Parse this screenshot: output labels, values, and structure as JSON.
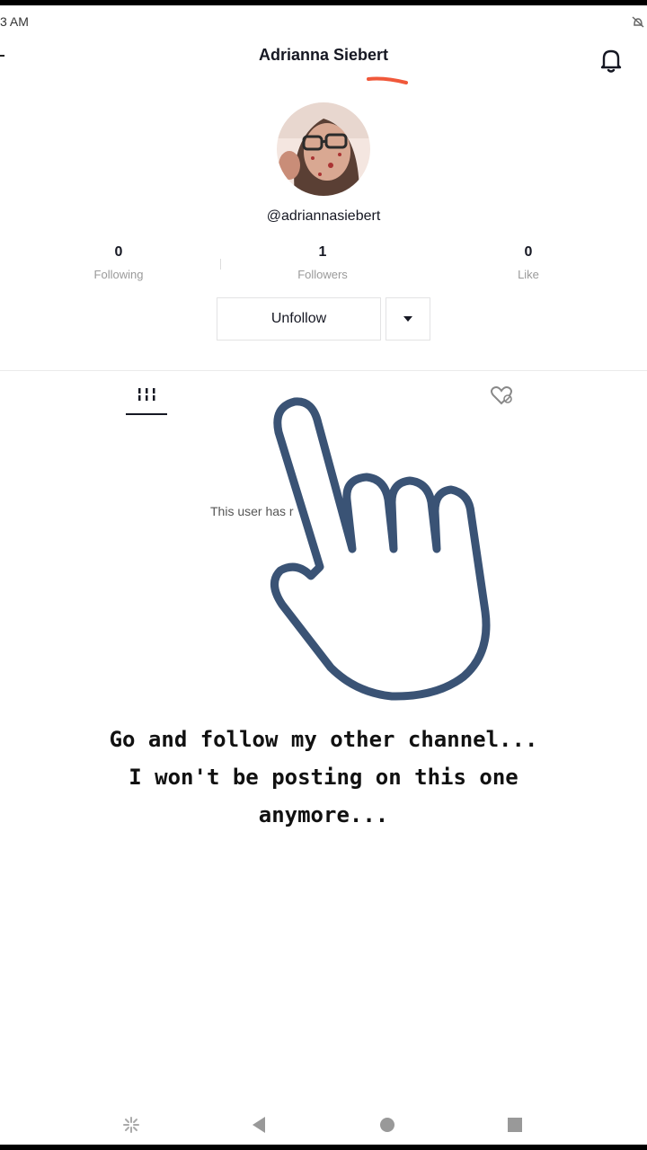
{
  "status_bar": {
    "time": "3 AM"
  },
  "header": {
    "title": "Adrianna Siebert"
  },
  "profile": {
    "handle": "@adriannasiebert"
  },
  "stats": [
    {
      "value": "0",
      "label": "Following"
    },
    {
      "value": "1",
      "label": "Followers"
    },
    {
      "value": "0",
      "label": "Like"
    }
  ],
  "actions": {
    "unfollow_label": "Unfollow"
  },
  "content": {
    "empty_text": "This user has r"
  },
  "overlay": {
    "caption_line1": "Go and follow my other channel...",
    "caption_line2": "I won't be posting on this one",
    "caption_line3": "anymore..."
  },
  "colors": {
    "accent_mark": "#f0583a",
    "hand_outline": "#3a5375",
    "text": "#161823"
  },
  "icons": [
    "back-arrow-icon",
    "bell-icon",
    "grid-videos-icon",
    "liked-heart-icon",
    "back-nav-icon",
    "home-nav-icon",
    "recents-nav-icon",
    "loading-spark-icon"
  ]
}
